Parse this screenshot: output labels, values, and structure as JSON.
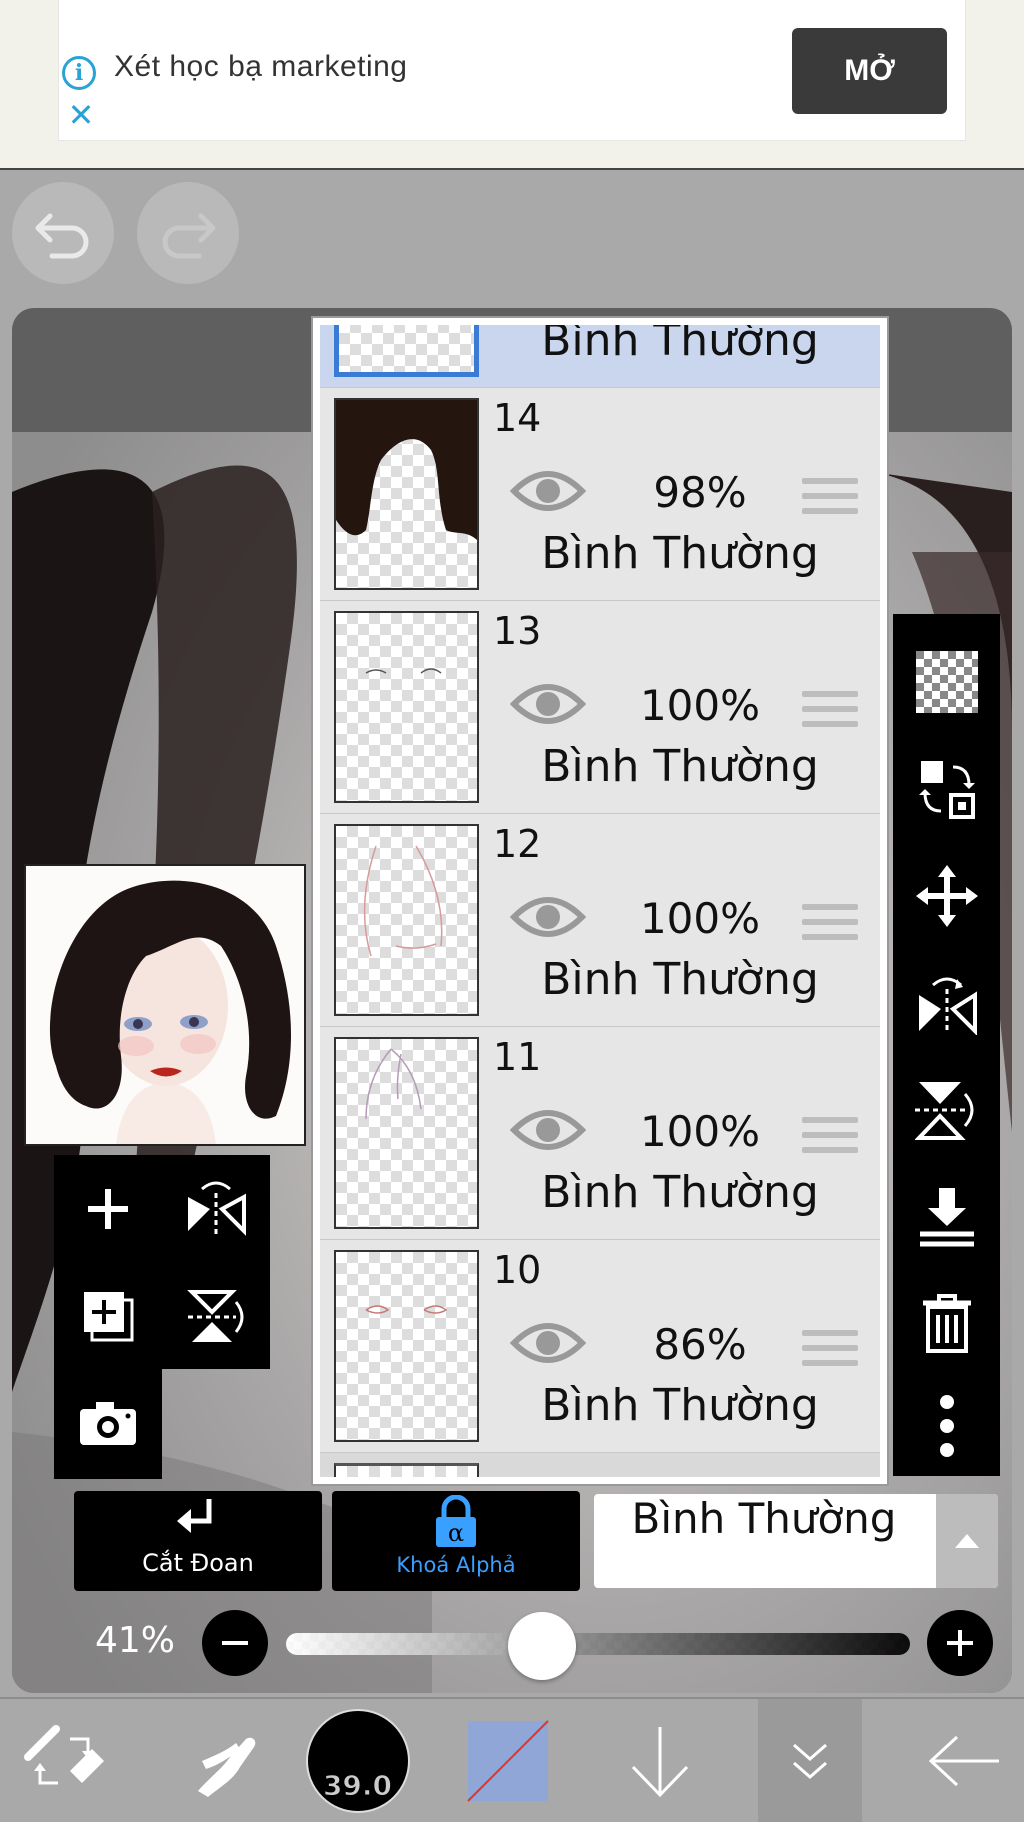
{
  "ad": {
    "title": "Xét học bạ marketing",
    "button_label": "MỞ",
    "info_icon": "i",
    "close_icon": "✕"
  },
  "colors": {
    "ad_accent": "#29a3d6",
    "selected_layer": "#c9d6ee",
    "alpha_lock_blue": "#3aa0ff",
    "canvas_bg": "#5f5f5f",
    "toolbar_gray": "#a9a9a9"
  },
  "layers_panel": {
    "top_partial_mode": "Bình Thường",
    "layers": [
      {
        "number": "14",
        "opacity": "98%",
        "mode": "Bình Thường"
      },
      {
        "number": "13",
        "opacity": "100%",
        "mode": "Bình Thường"
      },
      {
        "number": "12",
        "opacity": "100%",
        "mode": "Bình Thường"
      },
      {
        "number": "11",
        "opacity": "100%",
        "mode": "Bình Thường"
      },
      {
        "number": "10",
        "opacity": "86%",
        "mode": "Bình Thường"
      }
    ]
  },
  "bottom_controls": {
    "clip_label": "Cắt Đoan",
    "alpha_lock_label": "Khoá Alphả",
    "blend_mode": "Bình Thường",
    "opacity_percent": "41%",
    "opacity_value": 0.41
  },
  "toolbar": {
    "brush_size": "39.0"
  },
  "icons": {
    "undo": "undo-icon",
    "redo": "redo-icon",
    "add_layer": "plus-icon",
    "duplicate_layer": "duplicate-layer-icon",
    "camera": "camera-icon",
    "flip_h": "flip-horizontal-icon",
    "flip_v": "flip-vertical-icon",
    "transparency": "checkerboard-icon",
    "move": "move-icon",
    "delete": "trash-icon",
    "more": "more-vertical-icon"
  }
}
